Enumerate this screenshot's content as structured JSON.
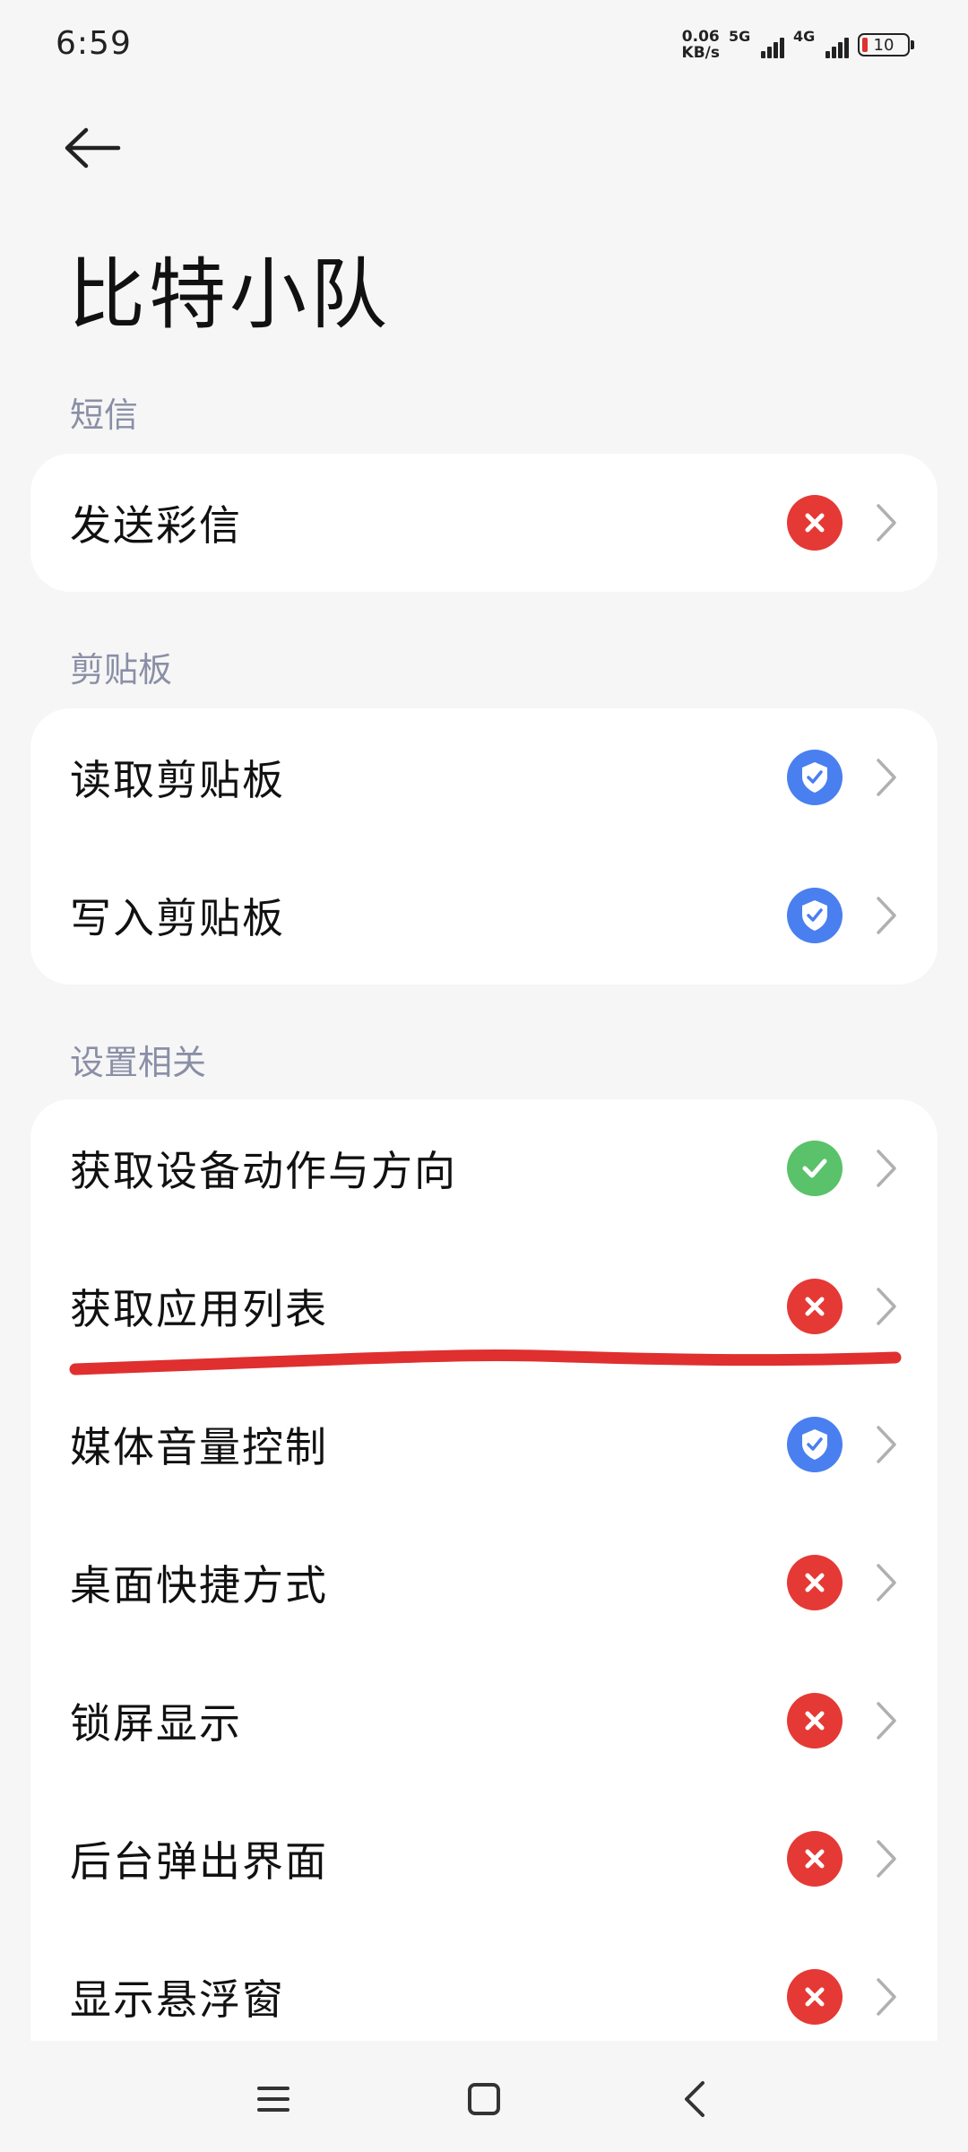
{
  "status_bar": {
    "time": "6:59",
    "net_speed_value": "0.06",
    "net_speed_unit": "KB/s",
    "sim1": "5G",
    "sim2": "4G",
    "battery": "10"
  },
  "header": {
    "title": "比特小队"
  },
  "sections": [
    {
      "title": "短信",
      "items": [
        {
          "label": "发送彩信",
          "status": "deny"
        }
      ]
    },
    {
      "title": "剪贴板",
      "items": [
        {
          "label": "读取剪贴板",
          "status": "ask"
        },
        {
          "label": "写入剪贴板",
          "status": "ask"
        }
      ]
    },
    {
      "title": "设置相关",
      "items": [
        {
          "label": "获取设备动作与方向",
          "status": "allow"
        },
        {
          "label": "获取应用列表",
          "status": "deny"
        },
        {
          "label": "媒体音量控制",
          "status": "ask"
        },
        {
          "label": "桌面快捷方式",
          "status": "deny"
        },
        {
          "label": "锁屏显示",
          "status": "deny"
        },
        {
          "label": "后台弹出界面",
          "status": "deny"
        },
        {
          "label": "显示悬浮窗",
          "status": "deny"
        }
      ]
    }
  ],
  "colors": {
    "deny": "#e53935",
    "ask": "#4a7ff0",
    "allow": "#5ac26a",
    "annotation": "#e02f2f"
  },
  "icons": {
    "deny": "x-icon",
    "ask": "shield-check-icon",
    "allow": "check-icon"
  }
}
